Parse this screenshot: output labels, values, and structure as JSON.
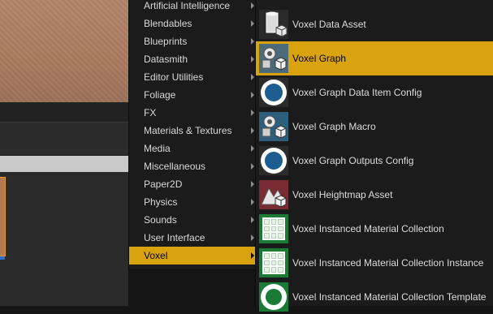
{
  "category_menu": {
    "items": [
      {
        "label": "Artificial Intelligence"
      },
      {
        "label": "Blendables"
      },
      {
        "label": "Blueprints"
      },
      {
        "label": "Datasmith"
      },
      {
        "label": "Editor Utilities"
      },
      {
        "label": "Foliage"
      },
      {
        "label": "FX"
      },
      {
        "label": "Materials & Textures"
      },
      {
        "label": "Media"
      },
      {
        "label": "Miscellaneous"
      },
      {
        "label": "Paper2D"
      },
      {
        "label": "Physics"
      },
      {
        "label": "Sounds"
      },
      {
        "label": "User Interface"
      },
      {
        "label": "Voxel"
      }
    ],
    "active": "Voxel"
  },
  "voxel_submenu": {
    "items": [
      {
        "label": "Voxel Data Asset",
        "icon": "voxel-data-asset-icon"
      },
      {
        "label": "Voxel Graph",
        "icon": "voxel-graph-icon"
      },
      {
        "label": "Voxel Graph Data Item Config",
        "icon": "config-ring-icon"
      },
      {
        "label": "Voxel Graph Macro",
        "icon": "voxel-graph-macro-icon"
      },
      {
        "label": "Voxel Graph Outputs Config",
        "icon": "config-ring-icon"
      },
      {
        "label": "Voxel Heightmap Asset",
        "icon": "heightmap-asset-icon"
      },
      {
        "label": "Voxel Instanced Material Collection",
        "icon": "material-collection-icon"
      },
      {
        "label": "Voxel Instanced Material Collection Instance",
        "icon": "material-collection-icon"
      },
      {
        "label": "Voxel Instanced Material Collection Template",
        "icon": "material-template-icon"
      }
    ],
    "active": "Voxel Graph"
  },
  "colors": {
    "highlight": "#d9a30f",
    "menu_background": "#1b1b1b",
    "text": "#dcdcdc"
  }
}
